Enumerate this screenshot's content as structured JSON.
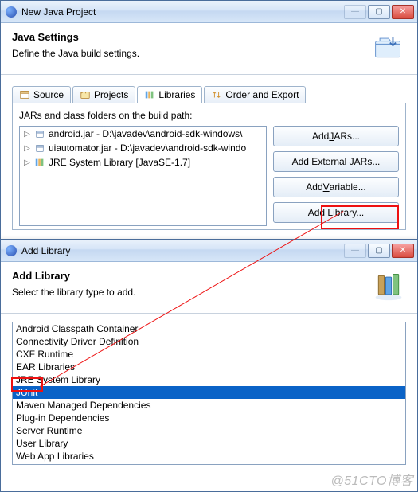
{
  "win1": {
    "title": "New Java Project",
    "minimize": "—",
    "maximize": "▢",
    "close": "✕",
    "heading": "Java Settings",
    "subtext": "Define the Java build settings.",
    "tabs": {
      "source": "Source",
      "projects": "Projects",
      "libraries": "Libraries",
      "order": "Order and Export"
    },
    "buildpath_label": "JARs and class folders on the build path:",
    "tree": {
      "row0": "android.jar - D:\\javadev\\android-sdk-windows\\",
      "row1": "uiautomator.jar - D:\\javadev\\android-sdk-windo",
      "row2": "JRE System Library [JavaSE-1.7]"
    },
    "buttons": {
      "addjars_pre": "Add ",
      "addjars_u": "J",
      "addjars_post": "ARs...",
      "addext_pre": "Add E",
      "addext_u": "x",
      "addext_post": "ternal JARs...",
      "addvar_pre": "Add ",
      "addvar_u": "V",
      "addvar_post": "ariable...",
      "addlib_pre": "Add L",
      "addlib_u": "i",
      "addlib_post": "brary..."
    }
  },
  "win2": {
    "title": "Add Library",
    "minimize": "—",
    "maximize": "▢",
    "close": "✕",
    "heading": "Add Library",
    "subtext": "Select the library type to add.",
    "items": {
      "0": "Android Classpath Container",
      "1": "Connectivity Driver Definition",
      "2": "CXF Runtime",
      "3": "EAR Libraries",
      "4": "JRE System Library",
      "5": "JUnit",
      "6": "Maven Managed Dependencies",
      "7": "Plug-in Dependencies",
      "8": "Server Runtime",
      "9": "User Library",
      "10": "Web App Libraries"
    }
  },
  "watermark": "@51CTO博客"
}
